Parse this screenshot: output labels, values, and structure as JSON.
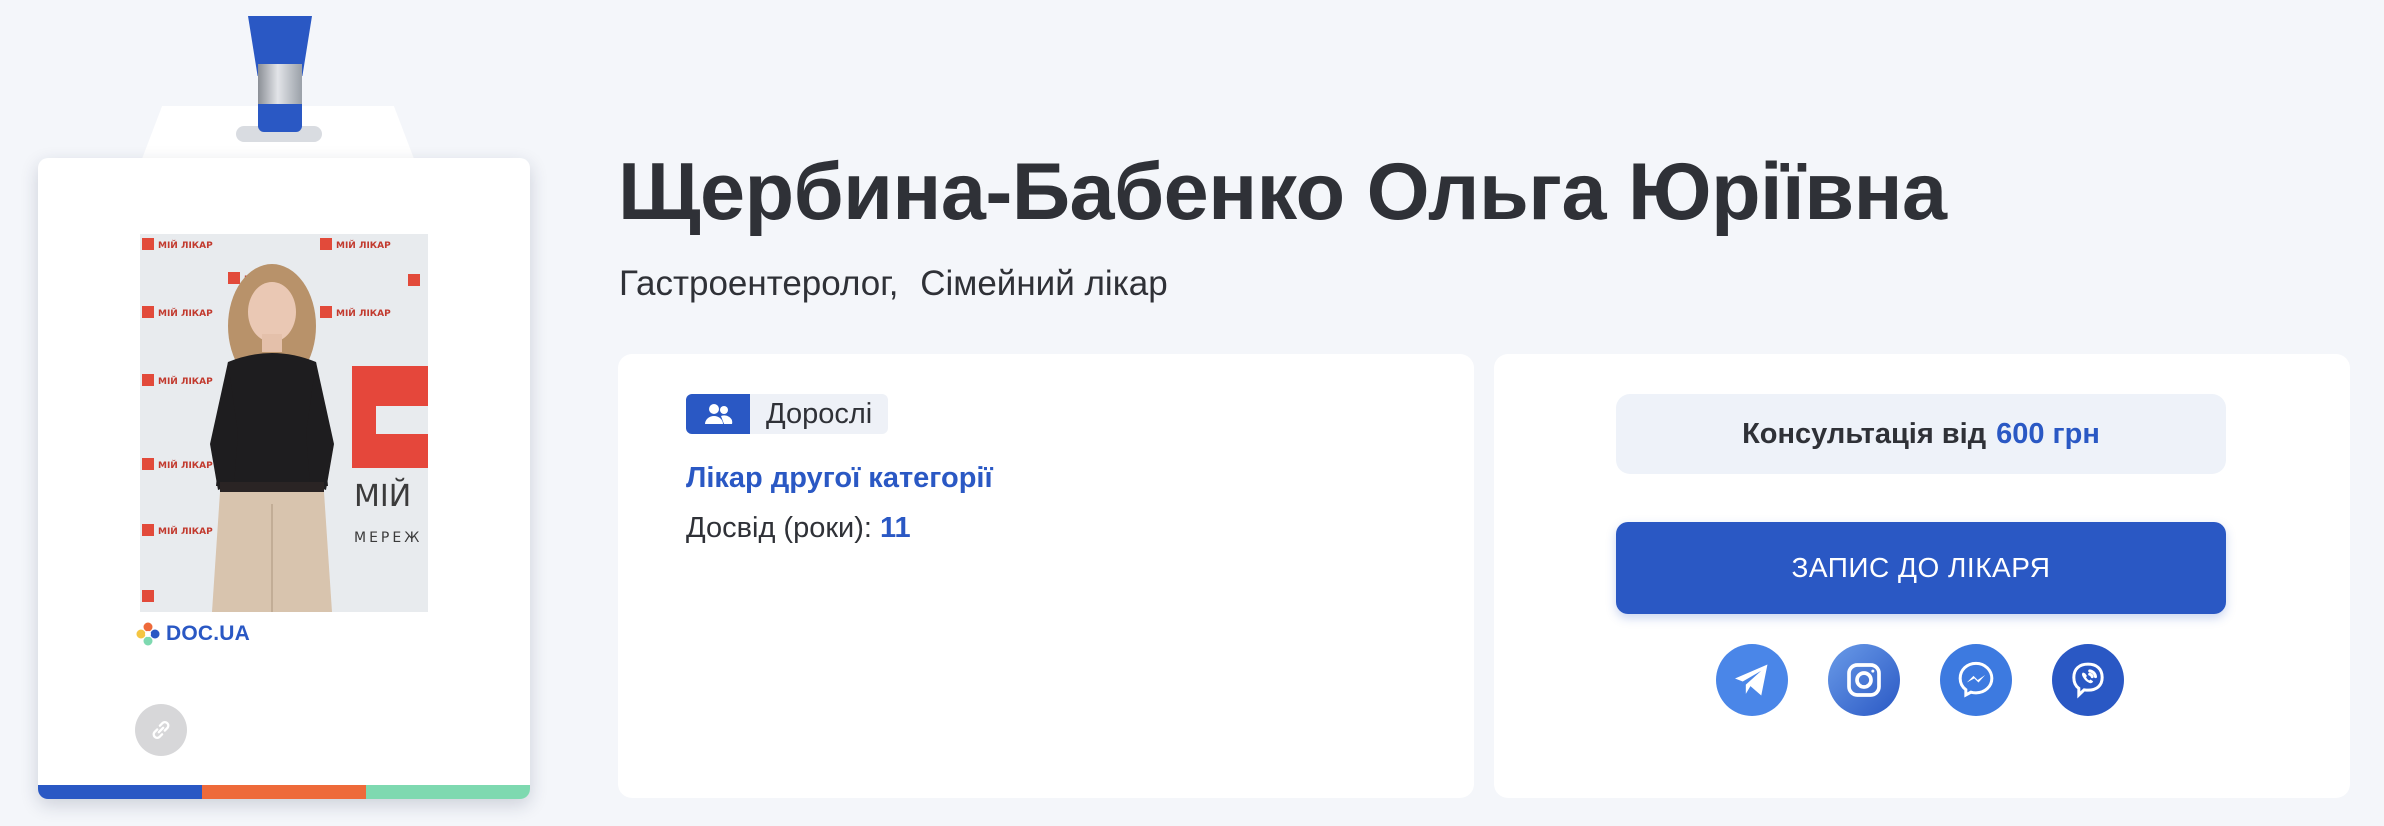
{
  "badge": {
    "brand": "DOC.UA",
    "photo_alt": "Щербина-Бабенко Ольга Юріївна",
    "photo_backdrop_text": "МІЙ ЛІКАР"
  },
  "doctor": {
    "name": "Щербина-Бабенко Ольга Юріївна",
    "specialties": [
      "Гастроентеролог,",
      "Сімейний лікар"
    ]
  },
  "info": {
    "patients_tag": "Дорослі",
    "category": "Лікар другої категорії",
    "experience_label": "Досвід (роки):",
    "experience_value": "11"
  },
  "booking": {
    "price_label": "Консультація від",
    "price_value": "600 грн",
    "button_label": "ЗАПИС ДО ЛІКАРЯ"
  },
  "socials": [
    {
      "name": "telegram",
      "icon": "telegram-icon"
    },
    {
      "name": "instagram",
      "icon": "instagram-icon"
    },
    {
      "name": "messenger",
      "icon": "messenger-icon"
    },
    {
      "name": "viber",
      "icon": "viber-icon"
    }
  ],
  "colors": {
    "accent": "#2a58c4",
    "background": "#f4f6fa",
    "stripe_blue": "#2a58c4",
    "stripe_orange": "#ee6a3a",
    "stripe_green": "#7ed9b0"
  }
}
